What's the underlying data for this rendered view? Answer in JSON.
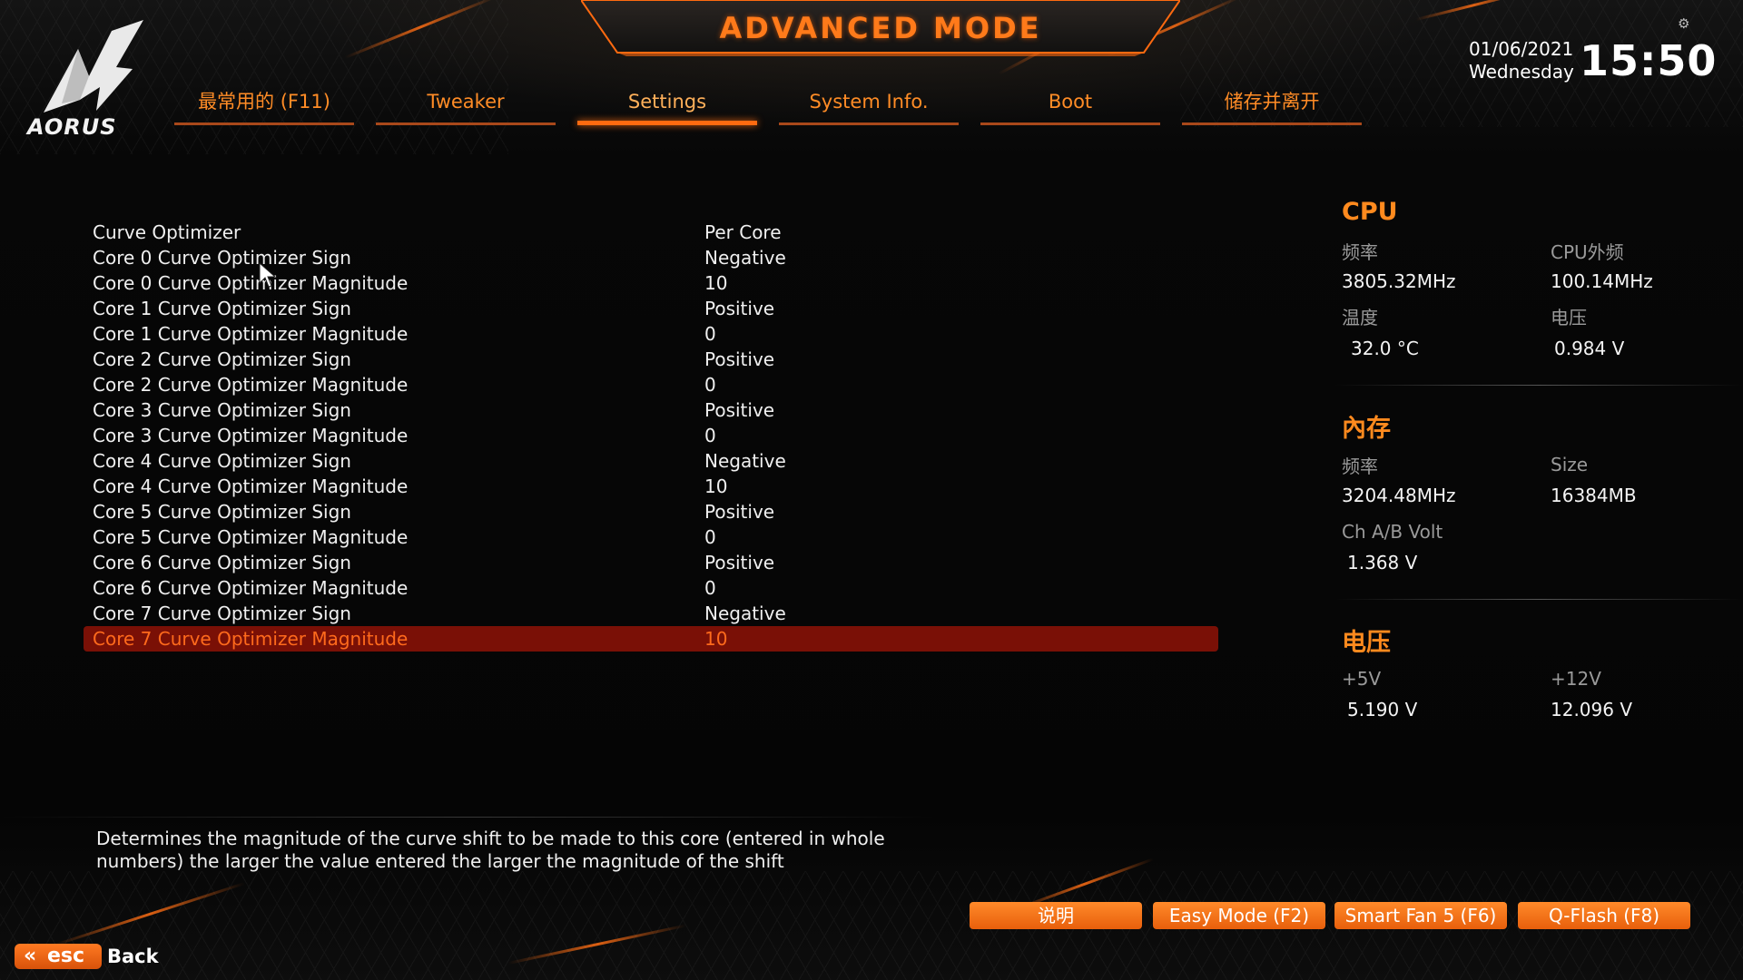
{
  "header": {
    "title": "ADVANCED MODE",
    "brand": "AORUS",
    "date": "01/06/2021",
    "weekday": "Wednesday",
    "time": "15:50"
  },
  "tabs": [
    {
      "label": "最常用的 (F11)",
      "active": false
    },
    {
      "label": "Tweaker",
      "active": false
    },
    {
      "label": "Settings",
      "active": true
    },
    {
      "label": "System Info.",
      "active": false
    },
    {
      "label": "Boot",
      "active": false
    },
    {
      "label": "储存并离开",
      "active": false
    }
  ],
  "settings": [
    {
      "name": "Curve Optimizer",
      "value": "Per Core"
    },
    {
      "name": "Core 0 Curve Optimizer Sign",
      "value": "Negative"
    },
    {
      "name": "Core 0 Curve Optimizer Magnitude",
      "value": "10"
    },
    {
      "name": "Core 1 Curve Optimizer Sign",
      "value": "Positive"
    },
    {
      "name": "Core 1 Curve Optimizer Magnitude",
      "value": "0"
    },
    {
      "name": "Core 2 Curve Optimizer Sign",
      "value": "Positive"
    },
    {
      "name": "Core 2 Curve Optimizer Magnitude",
      "value": "0"
    },
    {
      "name": "Core 3 Curve Optimizer Sign",
      "value": "Positive"
    },
    {
      "name": "Core 3 Curve Optimizer Magnitude",
      "value": "0"
    },
    {
      "name": "Core 4 Curve Optimizer Sign",
      "value": "Negative"
    },
    {
      "name": "Core 4 Curve Optimizer Magnitude",
      "value": "10"
    },
    {
      "name": "Core 5 Curve Optimizer Sign",
      "value": "Positive"
    },
    {
      "name": "Core 5 Curve Optimizer Magnitude",
      "value": "0"
    },
    {
      "name": "Core 6 Curve Optimizer Sign",
      "value": "Positive"
    },
    {
      "name": "Core 6 Curve Optimizer Magnitude",
      "value": "0"
    },
    {
      "name": "Core 7 Curve Optimizer Sign",
      "value": "Negative"
    },
    {
      "name": "Core 7 Curve Optimizer Magnitude",
      "value": "10",
      "selected": true
    }
  ],
  "info": {
    "cpu": {
      "title": "CPU",
      "freq_label": "频率",
      "freq_value": "3805.32MHz",
      "bclk_label": "CPU外频",
      "bclk_value": "100.14MHz",
      "temp_label": "温度",
      "temp_value": "32.0 °C",
      "volt_label": "电压",
      "volt_value": "0.984 V"
    },
    "memory": {
      "title": "內存",
      "freq_label": "频率",
      "freq_value": "3204.48MHz",
      "size_label": "Size",
      "size_value": "16384MB",
      "volt_label": "Ch A/B Volt",
      "volt_value": "1.368 V"
    },
    "voltage": {
      "title": "电压",
      "v5_label": "+5V",
      "v5_value": "5.190 V",
      "v12_label": "+12V",
      "v12_value": "12.096 V"
    }
  },
  "description": {
    "line1": "Determines the magnitude of the curve shift to be made to this core (entered in whole",
    "line2": "numbers) the larger the value entered the larger the magnitude of the shift"
  },
  "footer": {
    "help_label": "说明",
    "easy_mode_label": "Easy Mode (F2)",
    "smart_fan_label": "Smart Fan 5 (F6)",
    "qflash_label": "Q-Flash (F8)",
    "esc_label": "esc",
    "back_label": "Back"
  },
  "colors": {
    "accent": "#ff7a1a",
    "selected_row_bg": "#7a1006",
    "button": "#f07418"
  }
}
